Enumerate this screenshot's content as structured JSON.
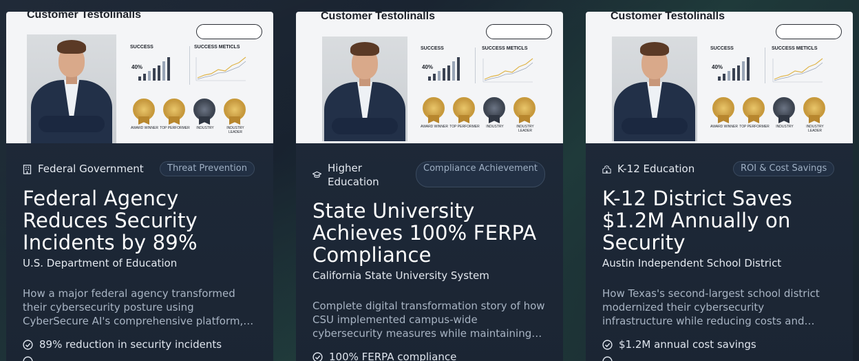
{
  "colors": {
    "background": "#1c2634",
    "card": "#1f2a3a",
    "tag_border": "#3a4a5e",
    "tag_text": "#9fb0c4",
    "text_primary": "#ffffff",
    "text_muted": "#a8b4c3"
  },
  "cards": [
    {
      "thumbnail": {
        "title": "Customer Testolinalls",
        "success_label": "SUCCESS",
        "success_pct": "40%",
        "metrics_label": "SUCCESS METICLS",
        "badges": [
          "AWARD WINNER",
          "TOP PERFORMER",
          "INDUSTRY",
          "INDUSTRY LEADER"
        ]
      },
      "category_icon": "building-icon",
      "category": "Federal Government",
      "tag": "Threat Prevention",
      "title": "Federal Agency Reduces Security Incidents by 89%",
      "organization": "U.S. Department of Education",
      "description": "How a major federal agency transformed their cybersecurity posture using CyberSecure AI's comprehensive platform, achieving dramatic reductions in security incidents.",
      "bullets": [
        "89% reduction in security incidents"
      ]
    },
    {
      "thumbnail": {
        "title": "Customer Testolinalls",
        "success_label": "SUCCESS",
        "success_pct": "40%",
        "metrics_label": "SUCCESS METICLS",
        "badges": [
          "AWARD WINNER",
          "TOP PERFORMER",
          "INDUSTRY",
          "INDUSTRY LEADER"
        ]
      },
      "category_icon": "graduation-cap-icon",
      "category": "Higher Education",
      "tag": "Compliance Achievement",
      "title": "State University Achieves 100% FERPA Compliance",
      "organization": "California State University System",
      "description": "Complete digital transformation story of how CSU implemented campus-wide cybersecurity measures while maintaining full FERPA compliance across every campus.",
      "bullets": [
        "100% FERPA compliance"
      ]
    },
    {
      "thumbnail": {
        "title": "Customer Testolinalls",
        "success_label": "SUCCESS",
        "success_pct": "40%",
        "metrics_label": "SUCCESS METICLS",
        "badges": [
          "AWARD WINNER",
          "TOP PERFORMER",
          "INDUSTRY",
          "INDUSTRY LEADER"
        ]
      },
      "category_icon": "school-icon",
      "category": "K-12 Education",
      "tag": "ROI & Cost Savings",
      "title": "K-12 District Saves $1.2M Annually on Security",
      "organization": "Austin Independent School District",
      "description": "How Texas's second-largest school district modernized their cybersecurity infrastructure while reducing costs and improving protection for students.",
      "bullets": [
        "$1.2M annual cost savings"
      ]
    }
  ]
}
